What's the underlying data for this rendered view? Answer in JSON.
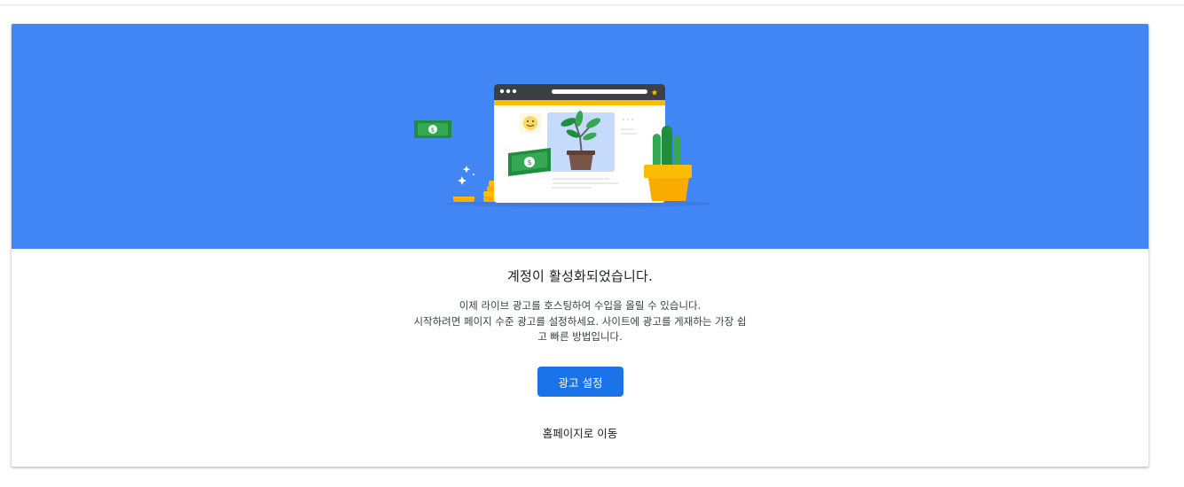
{
  "colors": {
    "hero_background": "#4285f4",
    "primary_button": "#1a73e8",
    "text_dark": "#202124",
    "text_body": "#3c4043"
  },
  "hero": {
    "illustration_icons": [
      "browser-window-icon",
      "plant-icon",
      "smiley-icon",
      "money-bill-icon",
      "coin-stack-icon",
      "sparkle-icon",
      "cactus-icon"
    ]
  },
  "content": {
    "title": "계정이 활성화되었습니다.",
    "description_line1": "이제 라이브 광고를 호스팅하여 수입을 올릴 수 있습니다.",
    "description_line2": "시작하려면 페이지 수준 광고를 설정하세요. 사이트에 광고를 게재하는 가장 쉽",
    "description_line3": "고 빠른 방법입니다.",
    "primary_button_label": "광고 설정",
    "home_link_label": "홈페이지로 이동"
  }
}
